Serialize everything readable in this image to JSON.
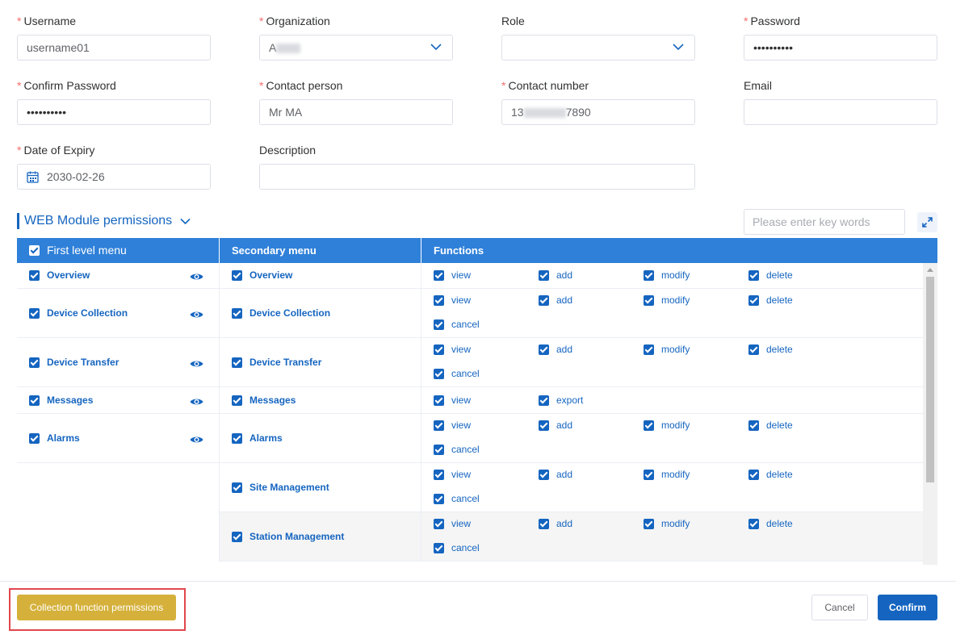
{
  "form": {
    "username": {
      "label": "Username",
      "value": "username01"
    },
    "organization": {
      "label": "Organization",
      "value": "A"
    },
    "role": {
      "label": "Role",
      "value": ""
    },
    "password": {
      "label": "Password",
      "value": "••••••••••"
    },
    "confirm_password": {
      "label": "Confirm Password",
      "value": "••••••••••"
    },
    "contact_person": {
      "label": "Contact person",
      "value": "Mr MA"
    },
    "contact_number": {
      "label": "Contact number",
      "value_prefix": "13",
      "value_suffix": "7890"
    },
    "email": {
      "label": "Email",
      "value": ""
    },
    "date_of_expiry": {
      "label": "Date of Expiry",
      "value": "2030-02-26"
    },
    "description": {
      "label": "Description",
      "value": ""
    },
    "required_mark": "*"
  },
  "permissions": {
    "section_title": "WEB Module permissions",
    "search_placeholder": "Please enter key words",
    "columns": [
      "First level menu",
      "Secondary menu",
      "Functions"
    ],
    "rows": [
      {
        "first": "Overview",
        "second": "Overview",
        "functions": [
          "view",
          "add",
          "modify",
          "delete"
        ]
      },
      {
        "first": "Device Collection",
        "second": "Device Collection",
        "functions": [
          "view",
          "add",
          "modify",
          "delete",
          "cancel"
        ]
      },
      {
        "first": "Device Transfer",
        "second": "Device Transfer",
        "functions": [
          "view",
          "add",
          "modify",
          "delete",
          "cancel"
        ]
      },
      {
        "first": "Messages",
        "second": "Messages",
        "functions": [
          "view",
          "export"
        ]
      },
      {
        "first": "Alarms",
        "second": "Alarms",
        "functions": [
          "view",
          "add",
          "modify",
          "delete",
          "cancel"
        ]
      },
      {
        "first": "",
        "second": "Site Management",
        "functions": [
          "view",
          "add",
          "modify",
          "delete",
          "cancel"
        ]
      },
      {
        "first": "",
        "second": "Station Management",
        "functions": [
          "view",
          "add",
          "modify",
          "delete",
          "cancel"
        ]
      }
    ]
  },
  "footer": {
    "collection_button": "Collection function permissions",
    "cancel_button": "Cancel",
    "confirm_button": "Confirm"
  },
  "colors": {
    "primary": "#1565c0",
    "header": "#2f80d9",
    "collection_button": "#d5b13c",
    "highlight": "#e0474c"
  }
}
